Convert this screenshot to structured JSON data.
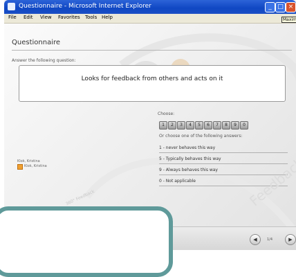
{
  "window": {
    "title": "Questionnaire - Microsoft Internet Explorer",
    "minimize_glyph": "_",
    "maximize_glyph": "□",
    "close_glyph": "×",
    "tooltip": "Maximize"
  },
  "menu": [
    "File",
    "Edit",
    "View",
    "Favorites",
    "Tools",
    "Help"
  ],
  "page": {
    "title": "Questionnaire",
    "prompt": "Answer the following question:",
    "question": "Looks for feedback from others and acts on it",
    "choose_label": "Choose:",
    "scale": [
      "1",
      "2",
      "3",
      "4",
      "5",
      "6",
      "7",
      "8",
      "9",
      "0"
    ],
    "or_label": "Or choose one of the following answers:",
    "answers": [
      "1 - never behaves this way",
      "5 - Typically behaves this way",
      "9 - Always behaves this way",
      "0 - Not applicable"
    ]
  },
  "ratee": {
    "name": "Klok, Kristina",
    "sub": "Klok, Kristina"
  },
  "watermark": {
    "small": "360° Feedback",
    "big": "Feedback"
  },
  "nav": {
    "prev_glyph": "◀",
    "next_glyph": "▶",
    "page_indicator": "1/4"
  }
}
